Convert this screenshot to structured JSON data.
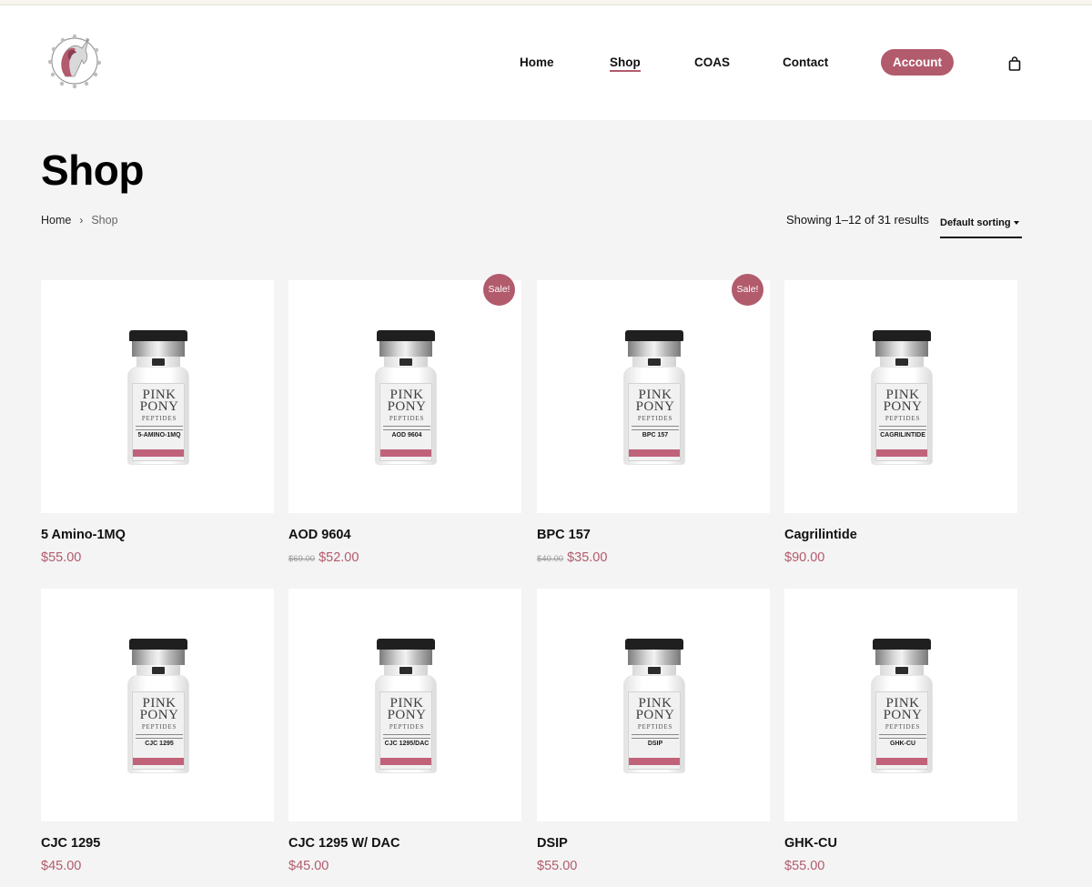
{
  "header": {
    "nav": [
      {
        "label": "Home"
      },
      {
        "label": "Shop"
      },
      {
        "label": "COAS"
      },
      {
        "label": "Contact"
      }
    ],
    "account_label": "Account",
    "cart_icon": "bag-icon",
    "logo_icon": "unicorn-logo-icon"
  },
  "page": {
    "title": "Shop",
    "breadcrumb": {
      "home": "Home",
      "separator": "›",
      "current": "Shop"
    },
    "results_text": "Showing 1–12 of 31 results",
    "sorting_label": "Default sorting"
  },
  "colors": {
    "accent": "#b25b6d",
    "background": "#f4f4f4"
  },
  "products": [
    {
      "name": "5 Amino-1MQ",
      "price": "$55.00",
      "old_price": "",
      "sale": "",
      "vial_label": "5-AMINO-1MQ"
    },
    {
      "name": "AOD 9604",
      "price": "$52.00",
      "old_price": "$69.00",
      "sale": "Sale!",
      "vial_label": "AOD 9604"
    },
    {
      "name": "BPC 157",
      "price": "$35.00",
      "old_price": "$40.00",
      "sale": "Sale!",
      "vial_label": "BPC 157"
    },
    {
      "name": "Cagrilintide",
      "price": "$90.00",
      "old_price": "",
      "sale": "",
      "vial_label": "CAGRILINTIDE"
    },
    {
      "name": "CJC 1295",
      "price": "$45.00",
      "old_price": "",
      "sale": "",
      "vial_label": "CJC 1295"
    },
    {
      "name": "CJC 1295 W/ DAC",
      "price": "$45.00",
      "old_price": "",
      "sale": "",
      "vial_label": "CJC 1295/DAC"
    },
    {
      "name": "DSIP",
      "price": "$55.00",
      "old_price": "",
      "sale": "",
      "vial_label": "DSIP"
    },
    {
      "name": "GHK-CU",
      "price": "$55.00",
      "old_price": "",
      "sale": "",
      "vial_label": "GHK-CU"
    }
  ],
  "vial_brand": {
    "line1": "PINK",
    "line2": "PONY",
    "line3": "PEPTIDES"
  }
}
